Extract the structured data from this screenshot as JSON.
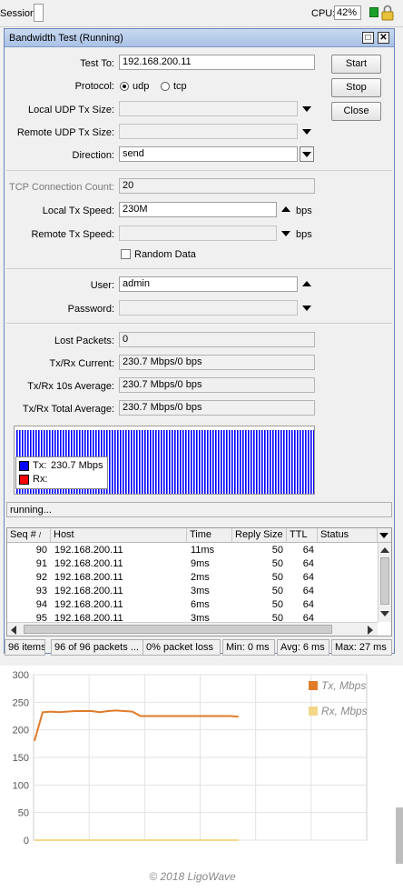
{
  "topbar": {
    "session_label": "Session:",
    "cpu_label": "CPU:",
    "cpu_value": "42%"
  },
  "window": {
    "title": "Bandwidth Test (Running)",
    "fields": {
      "test_to_label": "Test To:",
      "test_to_value": "192.168.200.11",
      "protocol_label": "Protocol:",
      "protocol_udp": "udp",
      "protocol_tcp": "tcp",
      "protocol_selected": "udp",
      "local_udp_label": "Local UDP Tx Size:",
      "remote_udp_label": "Remote UDP Tx Size:",
      "direction_label": "Direction:",
      "direction_value": "send",
      "tcp_conn_label": "TCP Connection Count:",
      "tcp_conn_value": "20",
      "local_tx_label": "Local Tx Speed:",
      "local_tx_value": "230M",
      "local_tx_unit": "bps",
      "remote_tx_label": "Remote Tx Speed:",
      "remote_tx_unit": "bps",
      "random_data_label": "Random Data",
      "user_label": "User:",
      "user_value": "admin",
      "password_label": "Password:",
      "lost_packets_label": "Lost Packets:",
      "lost_packets_value": "0",
      "current_label": "Tx/Rx Current:",
      "current_value": "230.7 Mbps/0 bps",
      "avg10_label": "Tx/Rx 10s Average:",
      "avg10_value": "230.7 Mbps/0 bps",
      "total_avg_label": "Tx/Rx Total Average:",
      "total_avg_value": "230.7 Mbps/0 bps"
    },
    "buttons": {
      "start": "Start",
      "stop": "Stop",
      "close": "Close"
    },
    "legend": {
      "tx_label": "Tx:",
      "tx_value": "230.7 Mbps",
      "rx_label": "Rx:",
      "tx_color": "#0000ff",
      "rx_color": "#ff0000"
    },
    "status_text": "running..."
  },
  "ping_table": {
    "columns": [
      "Seq #",
      "Host",
      "Time",
      "Reply Size",
      "TTL",
      "Status"
    ],
    "rows": [
      {
        "seq": "90",
        "host": "192.168.200.11",
        "time": "11ms",
        "size": "50",
        "ttl": "64",
        "status": ""
      },
      {
        "seq": "91",
        "host": "192.168.200.11",
        "time": "9ms",
        "size": "50",
        "ttl": "64",
        "status": ""
      },
      {
        "seq": "92",
        "host": "192.168.200.11",
        "time": "2ms",
        "size": "50",
        "ttl": "64",
        "status": ""
      },
      {
        "seq": "93",
        "host": "192.168.200.11",
        "time": "3ms",
        "size": "50",
        "ttl": "64",
        "status": ""
      },
      {
        "seq": "94",
        "host": "192.168.200.11",
        "time": "6ms",
        "size": "50",
        "ttl": "64",
        "status": ""
      },
      {
        "seq": "95",
        "host": "192.168.200.11",
        "time": "3ms",
        "size": "50",
        "ttl": "64",
        "status": ""
      }
    ],
    "footer": [
      "96 items",
      "96 of 96 packets ...",
      "0% packet loss",
      "Min: 0 ms",
      "Avg: 6 ms",
      "Max: 27 ms"
    ]
  },
  "chart_data": {
    "type": "line",
    "title": "",
    "ylim": [
      0,
      300
    ],
    "yticks": [
      "0",
      "50",
      "100",
      "150",
      "200",
      "250",
      "300"
    ],
    "series": [
      {
        "name": "Tx, Mbps",
        "color": "#e07b28",
        "values": [
          180,
          232,
          233,
          232,
          233,
          234,
          234,
          234,
          232,
          234,
          235,
          234,
          233,
          225,
          225,
          225,
          225,
          225,
          225,
          225,
          225,
          225,
          225,
          225,
          225,
          224
        ]
      },
      {
        "name": "Rx, Mbps",
        "color": "#f5d78a",
        "values": [
          0,
          0,
          0,
          0,
          0,
          0,
          0,
          0,
          0,
          0,
          0,
          0,
          0,
          0,
          0,
          0,
          0,
          0,
          0,
          0,
          0,
          0,
          0,
          0,
          0,
          0
        ]
      }
    ]
  },
  "copyright": "© 2018 LigoWave"
}
